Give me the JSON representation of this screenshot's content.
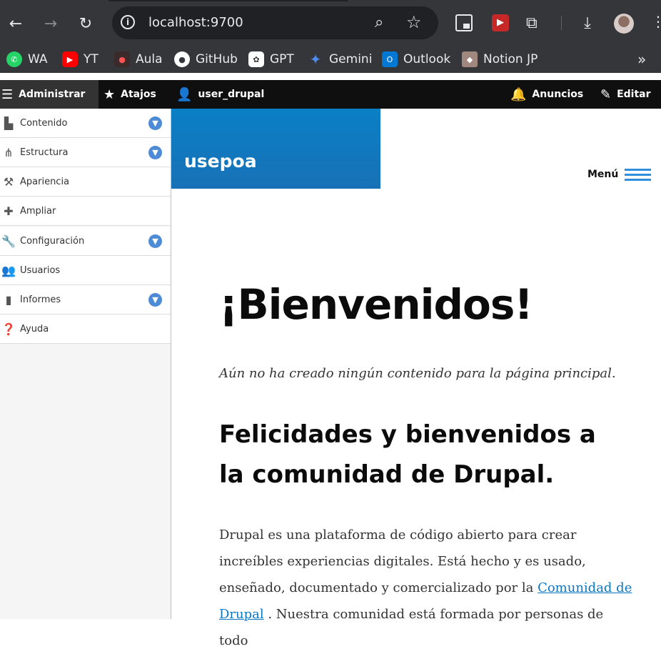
{
  "browser": {
    "url": "localhost:9700",
    "bookmarks": [
      {
        "label": "WA",
        "icon": "whatsapp-icon",
        "color": "#25d366"
      },
      {
        "label": "YT",
        "icon": "youtube-icon",
        "color": "#ff0000"
      },
      {
        "label": "Aula",
        "icon": "aula-icon",
        "color": "#b71c1c"
      },
      {
        "label": "GitHub",
        "icon": "github-icon",
        "color": "#ffffff"
      },
      {
        "label": "GPT",
        "icon": "chatgpt-icon",
        "color": "#ffffff"
      },
      {
        "label": "Gemini",
        "icon": "gemini-icon",
        "color": "#4285f4"
      },
      {
        "label": "Outlook",
        "icon": "outlook-icon",
        "color": "#0078d4"
      },
      {
        "label": "Notion JP",
        "icon": "notion-icon",
        "color": "#a1887f"
      }
    ]
  },
  "toolbar": {
    "administrar": "Administrar",
    "atajos": "Atajos",
    "user": "user_drupal",
    "anuncios": "Anuncios",
    "editar": "Editar"
  },
  "sidebar": {
    "items": [
      {
        "label": "Contenido",
        "icon": "file-icon",
        "expandable": true
      },
      {
        "label": "Estructura",
        "icon": "sitemap-icon",
        "expandable": true
      },
      {
        "label": "Apariencia",
        "icon": "brush-icon",
        "expandable": false
      },
      {
        "label": "Ampliar",
        "icon": "puzzle-icon",
        "expandable": false
      },
      {
        "label": "Configuración",
        "icon": "wrench-icon",
        "expandable": true
      },
      {
        "label": "Usuarios",
        "icon": "people-icon",
        "expandable": false
      },
      {
        "label": "Informes",
        "icon": "bar-chart-icon",
        "expandable": true
      },
      {
        "label": "Ayuda",
        "icon": "help-icon",
        "expandable": false
      }
    ]
  },
  "site": {
    "name": "usepoa",
    "menu_label": "Menú"
  },
  "content": {
    "title": "¡Bienvenidos!",
    "subtitle": "Aún no ha creado ningún contenido para la página principal.",
    "heading": "Felicidades y bienvenidos a la comunidad de Drupal.",
    "para_before": "Drupal es una plataforma de código abierto para crear increíbles experiencias digitales. Está hecho y es usado, enseñado, documentado y comercializado por la ",
    "para_link": "Comunidad de Drupal",
    "para_after": " . Nuestra comunidad está formada por personas de todo"
  },
  "colors": {
    "accent": "#0a77c4",
    "toolbar_bg": "#0f0f0f",
    "header_blue": "#1a7fc4"
  }
}
